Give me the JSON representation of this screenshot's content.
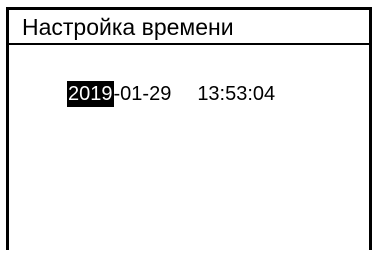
{
  "screen": {
    "title": "Настройка времени"
  },
  "datetime": {
    "year": "2019",
    "month_day": "-01-29",
    "time": "13:53:04"
  },
  "colors": {
    "background": "#ffffff",
    "foreground": "#000000",
    "selection_background": "#000000",
    "selection_text": "#ffffff"
  }
}
